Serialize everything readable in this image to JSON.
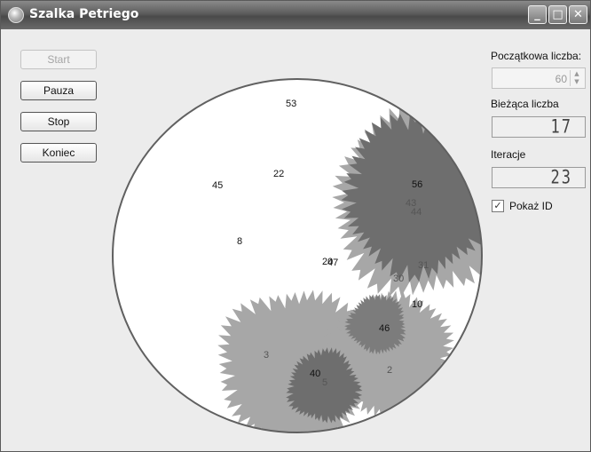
{
  "window": {
    "title": "Szalka Petriego"
  },
  "buttons": {
    "start": "Start",
    "pause": "Pauza",
    "stop": "Stop",
    "end": "Koniec"
  },
  "panel": {
    "initial_count_label": "Początkowa liczba:",
    "initial_count_value": "60",
    "current_count_label": "Bieżąca liczba",
    "current_count_value": "17",
    "iterations_label": "Iteracje",
    "iterations_value": "23",
    "show_id_label": "Pokaż ID",
    "show_id_checked": true
  },
  "colony_ids": [
    {
      "id": "53",
      "tone": "dark"
    },
    {
      "id": "22",
      "tone": "dark"
    },
    {
      "id": "45",
      "tone": "dark"
    },
    {
      "id": "8",
      "tone": "dark"
    },
    {
      "id": "56",
      "tone": "dark"
    },
    {
      "id": "43",
      "tone": "light"
    },
    {
      "id": "44",
      "tone": "light"
    },
    {
      "id": "20",
      "tone": "dark"
    },
    {
      "id": "47",
      "tone": "dark"
    },
    {
      "id": "31",
      "tone": "light"
    },
    {
      "id": "30",
      "tone": "light"
    },
    {
      "id": "10",
      "tone": "dark"
    },
    {
      "id": "46",
      "tone": "dark"
    },
    {
      "id": "3",
      "tone": "light"
    },
    {
      "id": "40",
      "tone": "dark"
    },
    {
      "id": "5",
      "tone": "light"
    },
    {
      "id": "2",
      "tone": "light"
    }
  ],
  "colors": {
    "colony_dark": "#6e6e6e",
    "colony_mid": "#a7a7a7",
    "colony_blue": "#7c7c7c",
    "dish_border": "#606060"
  }
}
